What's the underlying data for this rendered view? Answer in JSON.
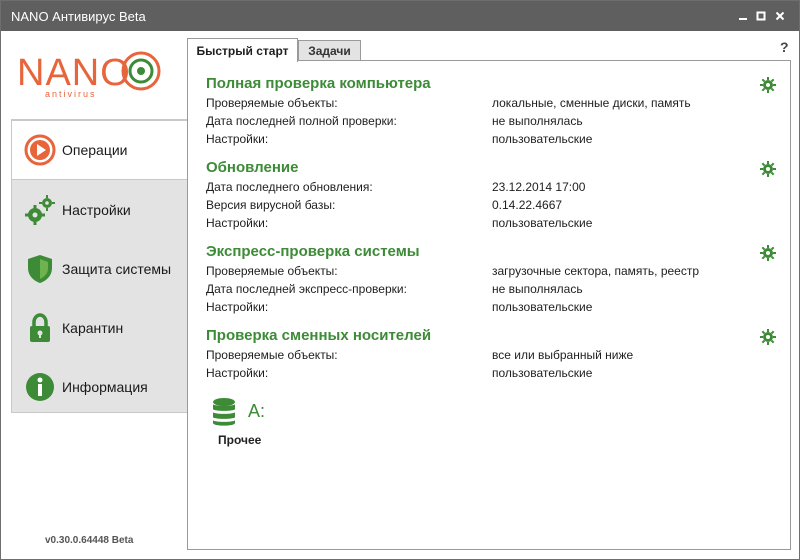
{
  "window": {
    "title": "NANO Антивирус Beta"
  },
  "logo": {
    "brand": "NANO",
    "sub": "antivirus"
  },
  "sidebar": {
    "items": [
      {
        "label": "Операции",
        "icon": "play-circle-icon",
        "active": true
      },
      {
        "label": "Настройки",
        "icon": "gears-icon",
        "active": false
      },
      {
        "label": "Защита системы",
        "icon": "shield-icon",
        "active": false
      },
      {
        "label": "Карантин",
        "icon": "lock-icon",
        "active": false
      },
      {
        "label": "Информация",
        "icon": "info-icon",
        "active": false
      }
    ],
    "version": "v0.30.0.64448 Beta"
  },
  "tabs": [
    {
      "label": "Быстрый старт",
      "active": true
    },
    {
      "label": "Задачи",
      "active": false
    }
  ],
  "help_label": "?",
  "sections": [
    {
      "title": "Полная проверка компьютера",
      "rows": [
        {
          "key": "Проверяемые объекты:",
          "value": "локальные, сменные диски, память"
        },
        {
          "key": "Дата последней полной проверки:",
          "value": "не выполнялась"
        },
        {
          "key": "Настройки:",
          "value": "пользовательские"
        }
      ]
    },
    {
      "title": "Обновление",
      "rows": [
        {
          "key": "Дата последнего обновления:",
          "value": "23.12.2014 17:00"
        },
        {
          "key": "Версия вирусной базы:",
          "value": "0.14.22.4667"
        },
        {
          "key": "Настройки:",
          "value": "пользовательские"
        }
      ]
    },
    {
      "title": "Экспресс-проверка системы",
      "rows": [
        {
          "key": "Проверяемые объекты:",
          "value": "загрузочные сектора, память, реестр"
        },
        {
          "key": "Дата последней экспресс-проверки:",
          "value": "не выполнялась"
        },
        {
          "key": "Настройки:",
          "value": "пользовательские"
        }
      ]
    },
    {
      "title": "Проверка сменных носителей",
      "rows": [
        {
          "key": "Проверяемые объекты:",
          "value": "все или выбранный ниже"
        },
        {
          "key": "Настройки:",
          "value": "пользовательские"
        }
      ]
    }
  ],
  "drive": {
    "letter": "A:",
    "label": "Прочее"
  },
  "colors": {
    "accent_green": "#3d8b37",
    "logo_orange": "#e8643a",
    "titlebar": "#5f5f5f"
  }
}
